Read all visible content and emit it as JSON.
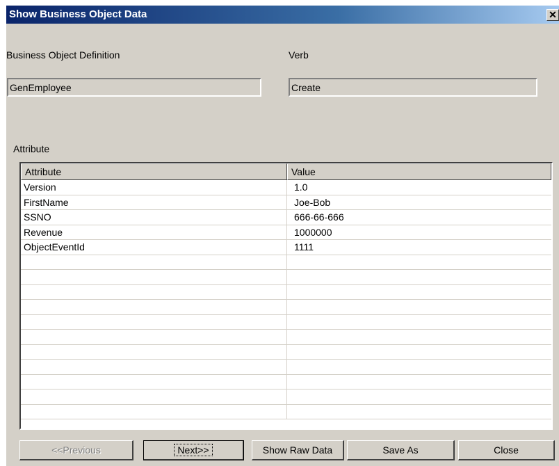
{
  "window": {
    "title": "Show Business Object Data",
    "close_glyph": "✕"
  },
  "fields": {
    "bo_definition_label": "Business Object Definition",
    "bo_definition_value": "GenEmployee",
    "verb_label": "Verb",
    "verb_value": "Create"
  },
  "attribute_section_label": "Attribute",
  "table": {
    "columns": [
      "Attribute",
      "Value"
    ],
    "rows": [
      {
        "attribute": "Version",
        "value": "1.0"
      },
      {
        "attribute": "FirstName",
        "value": "Joe-Bob"
      },
      {
        "attribute": "SSNO",
        "value": "666-66-666"
      },
      {
        "attribute": "Revenue",
        "value": "1000000"
      },
      {
        "attribute": "ObjectEventId",
        "value": "1111"
      },
      {
        "attribute": "",
        "value": ""
      },
      {
        "attribute": "",
        "value": ""
      },
      {
        "attribute": "",
        "value": ""
      },
      {
        "attribute": "",
        "value": ""
      },
      {
        "attribute": "",
        "value": ""
      },
      {
        "attribute": "",
        "value": ""
      },
      {
        "attribute": "",
        "value": ""
      },
      {
        "attribute": "",
        "value": ""
      },
      {
        "attribute": "",
        "value": ""
      },
      {
        "attribute": "",
        "value": ""
      },
      {
        "attribute": "",
        "value": ""
      }
    ]
  },
  "buttons": {
    "previous": "<<Previous",
    "next": "Next>>",
    "show_raw": "Show Raw Data",
    "save_as": "Save As",
    "close": "Close"
  }
}
